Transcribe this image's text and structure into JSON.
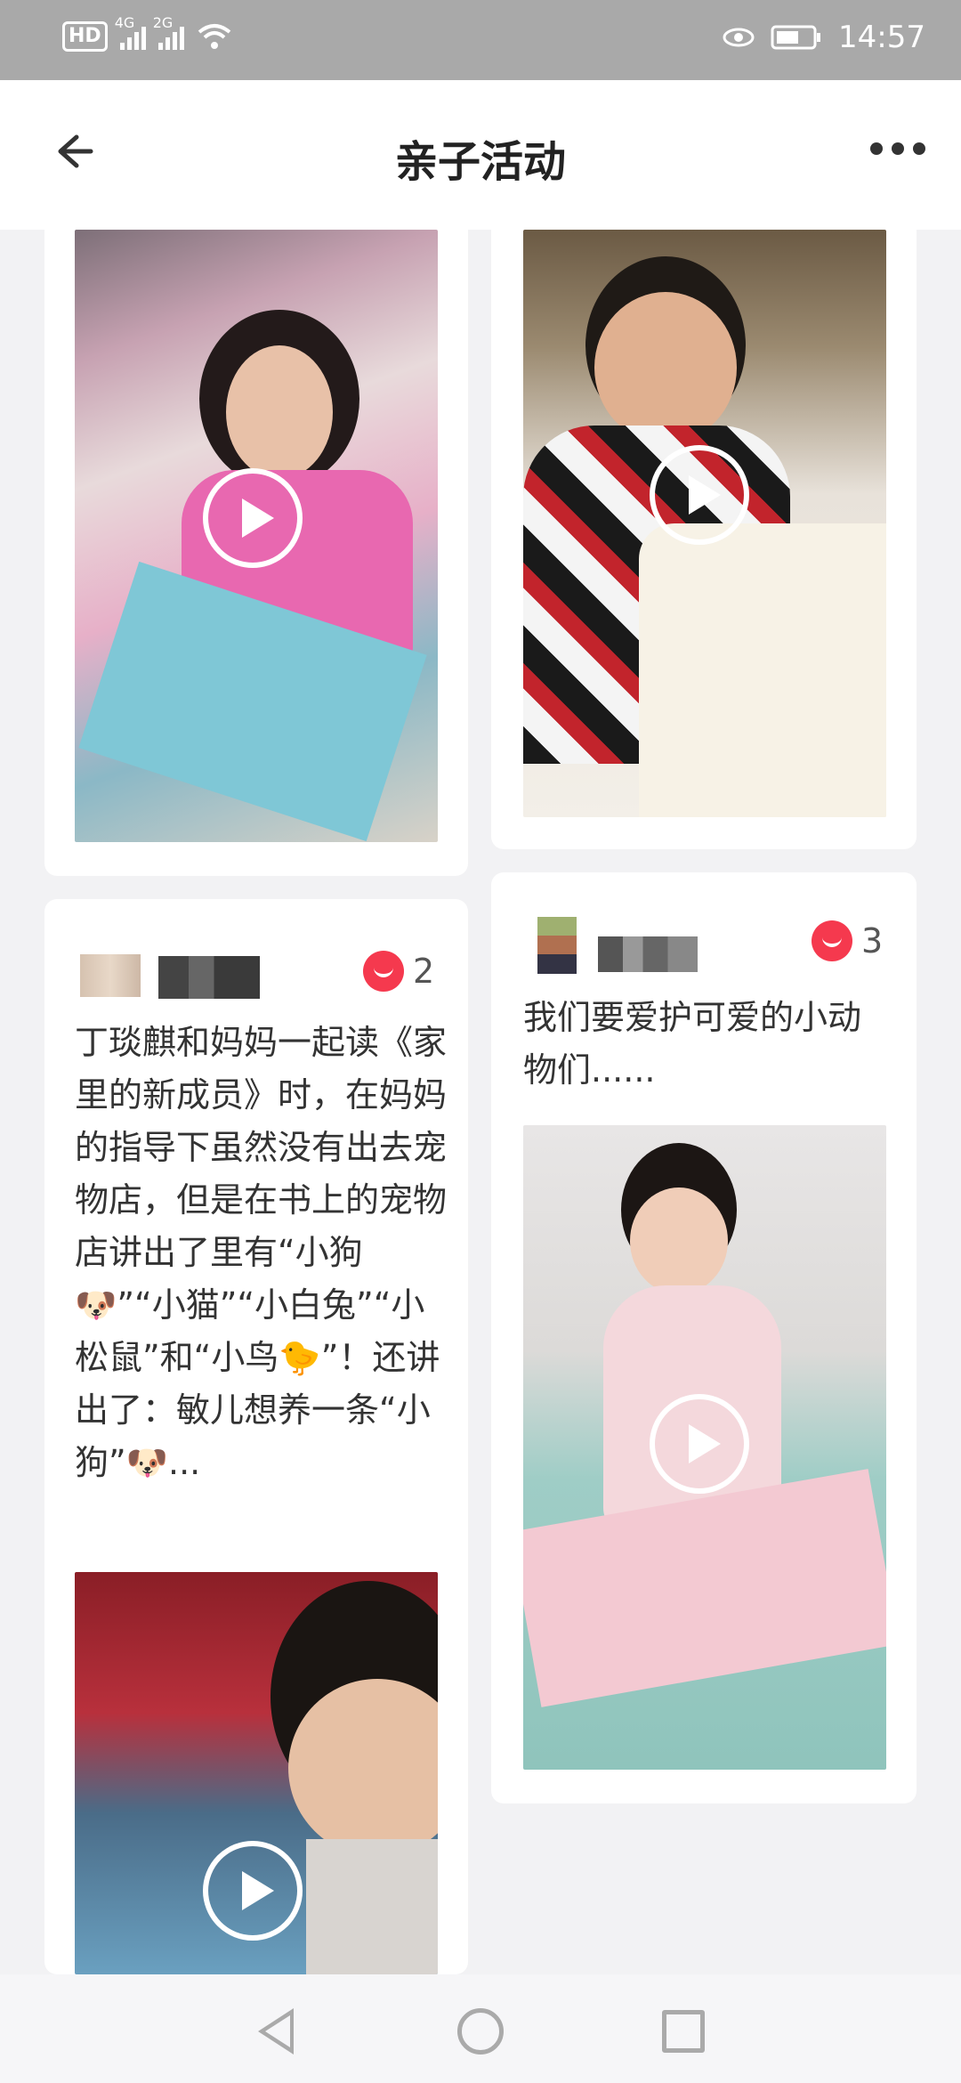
{
  "status": {
    "time": "14:57",
    "network1": "4G",
    "network2": "2G",
    "hd": "HD"
  },
  "header": {
    "title": "亲子活动"
  },
  "posts": [
    {
      "likes": "2",
      "description": "丁琰麒和妈妈一起读《家里的新成员》时，在妈妈的指导下虽然没有出去宠物店，但是在书上的宠物店讲出了里有“小狗🐶”“小猫”“小白兔”“小松鼠”和“小鸟🐤”！还讲出了：敏儿想养一条“小狗”🐶..."
    },
    {
      "likes": "3",
      "description": "我们要爱护可爱的小动物们......"
    }
  ],
  "colors": {
    "accent": "#f5394e",
    "statusbar": "#a9a9a9",
    "background": "#f2f2f4"
  },
  "icons": {
    "back": "back-arrow-icon",
    "more": "more-dots-icon",
    "play": "play-icon",
    "like": "heart-icon"
  }
}
